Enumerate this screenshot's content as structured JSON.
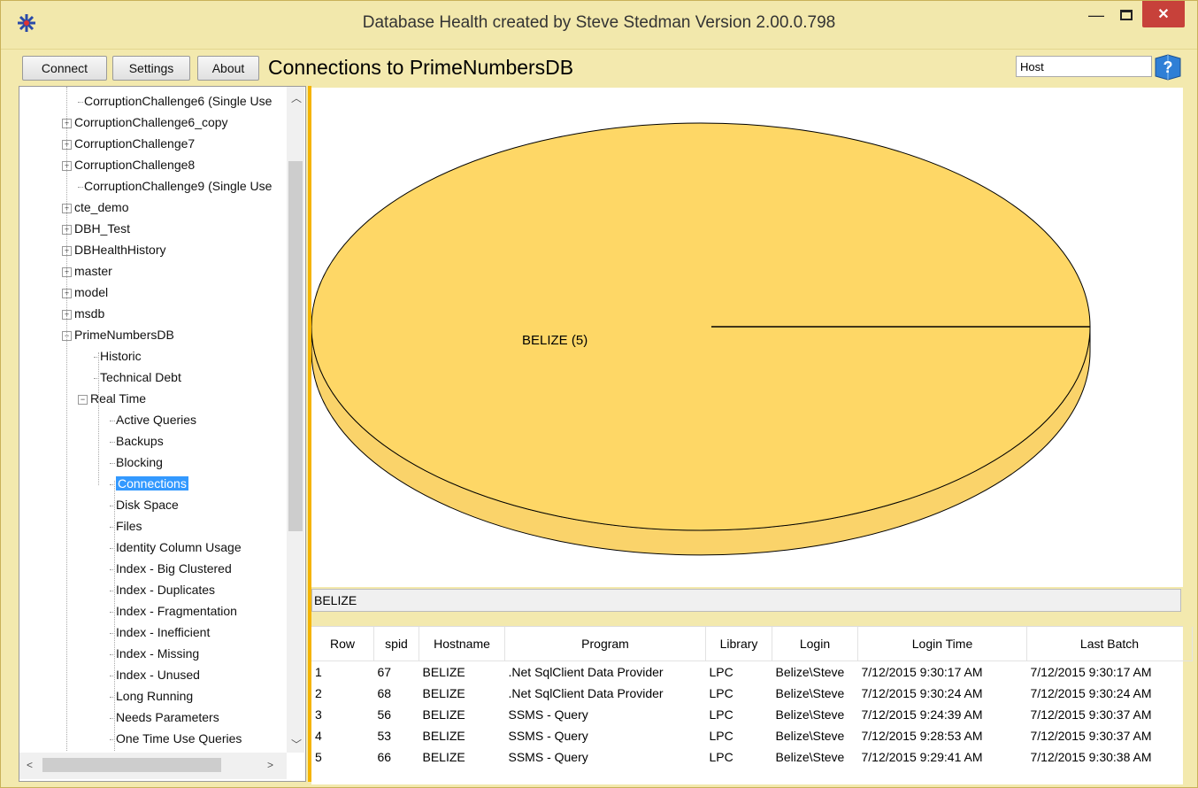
{
  "window": {
    "title": "Database Health created by Steve Stedman Version 2.00.0.798"
  },
  "toolbar": {
    "connect_label": "Connect",
    "settings_label": "Settings",
    "about_label": "About",
    "page_title": "Connections to PrimeNumbersDB",
    "host_value": "Host"
  },
  "tree": {
    "items": [
      {
        "label": "CorruptionChallenge6 (Single Use",
        "expander": ""
      },
      {
        "label": "CorruptionChallenge6_copy",
        "expander": "+"
      },
      {
        "label": "CorruptionChallenge7",
        "expander": "+"
      },
      {
        "label": "CorruptionChallenge8",
        "expander": "+"
      },
      {
        "label": "CorruptionChallenge9 (Single Use",
        "expander": ""
      },
      {
        "label": "cte_demo",
        "expander": "+"
      },
      {
        "label": "DBH_Test",
        "expander": "+"
      },
      {
        "label": "DBHealthHistory",
        "expander": "+"
      },
      {
        "label": "master",
        "expander": "+"
      },
      {
        "label": "model",
        "expander": "+"
      },
      {
        "label": "msdb",
        "expander": "+"
      },
      {
        "label": "PrimeNumbersDB",
        "expander": "−"
      },
      {
        "label": "Historic",
        "expander": ""
      },
      {
        "label": "Technical Debt",
        "expander": ""
      },
      {
        "label": "Real Time",
        "expander": "−"
      },
      {
        "label": "Active Queries",
        "expander": ""
      },
      {
        "label": "Backups",
        "expander": ""
      },
      {
        "label": "Blocking",
        "expander": ""
      },
      {
        "label": "Connections",
        "expander": ""
      },
      {
        "label": "Disk Space",
        "expander": ""
      },
      {
        "label": "Files",
        "expander": ""
      },
      {
        "label": "Identity Column Usage",
        "expander": ""
      },
      {
        "label": "Index - Big Clustered",
        "expander": ""
      },
      {
        "label": "Index - Duplicates",
        "expander": ""
      },
      {
        "label": "Index - Fragmentation",
        "expander": ""
      },
      {
        "label": "Index - Inefficient",
        "expander": ""
      },
      {
        "label": "Index - Missing",
        "expander": ""
      },
      {
        "label": "Index - Unused",
        "expander": ""
      },
      {
        "label": "Long Running",
        "expander": ""
      },
      {
        "label": "Needs Parameters",
        "expander": ""
      },
      {
        "label": "One Time Use Queries",
        "expander": ""
      }
    ],
    "selected": "Connections"
  },
  "chart_data": {
    "type": "pie",
    "categories": [
      "BELIZE"
    ],
    "values": [
      5
    ],
    "slice_labels": [
      "BELIZE (5)"
    ],
    "colors": [
      "#fed766"
    ]
  },
  "selection_bar": {
    "text": "BELIZE"
  },
  "grid": {
    "columns": [
      "Row",
      "spid",
      "Hostname",
      "Program",
      "Library",
      "Login",
      "Login Time",
      "Last Batch"
    ],
    "rows": [
      [
        "1",
        "67",
        "BELIZE",
        ".Net SqlClient Data Provider",
        "LPC",
        "Belize\\Steve",
        "7/12/2015 9:30:17 AM",
        "7/12/2015 9:30:17 AM"
      ],
      [
        "2",
        "68",
        "BELIZE",
        ".Net SqlClient Data Provider",
        "LPC",
        "Belize\\Steve",
        "7/12/2015 9:30:24 AM",
        "7/12/2015 9:30:24 AM"
      ],
      [
        "3",
        "56",
        "BELIZE",
        "SSMS - Query",
        "LPC",
        "Belize\\Steve",
        "7/12/2015 9:24:39 AM",
        "7/12/2015 9:30:37 AM"
      ],
      [
        "4",
        "53",
        "BELIZE",
        "SSMS - Query",
        "LPC",
        "Belize\\Steve",
        "7/12/2015 9:28:53 AM",
        "7/12/2015 9:30:37 AM"
      ],
      [
        "5",
        "66",
        "BELIZE",
        "SSMS - Query",
        "LPC",
        "Belize\\Steve",
        "7/12/2015 9:29:41 AM",
        "7/12/2015 9:30:38 AM"
      ]
    ]
  },
  "colors": {
    "accent": "#f5b400",
    "background": "#f3e9ae",
    "selection": "#3399ff",
    "close": "#c7413a"
  }
}
